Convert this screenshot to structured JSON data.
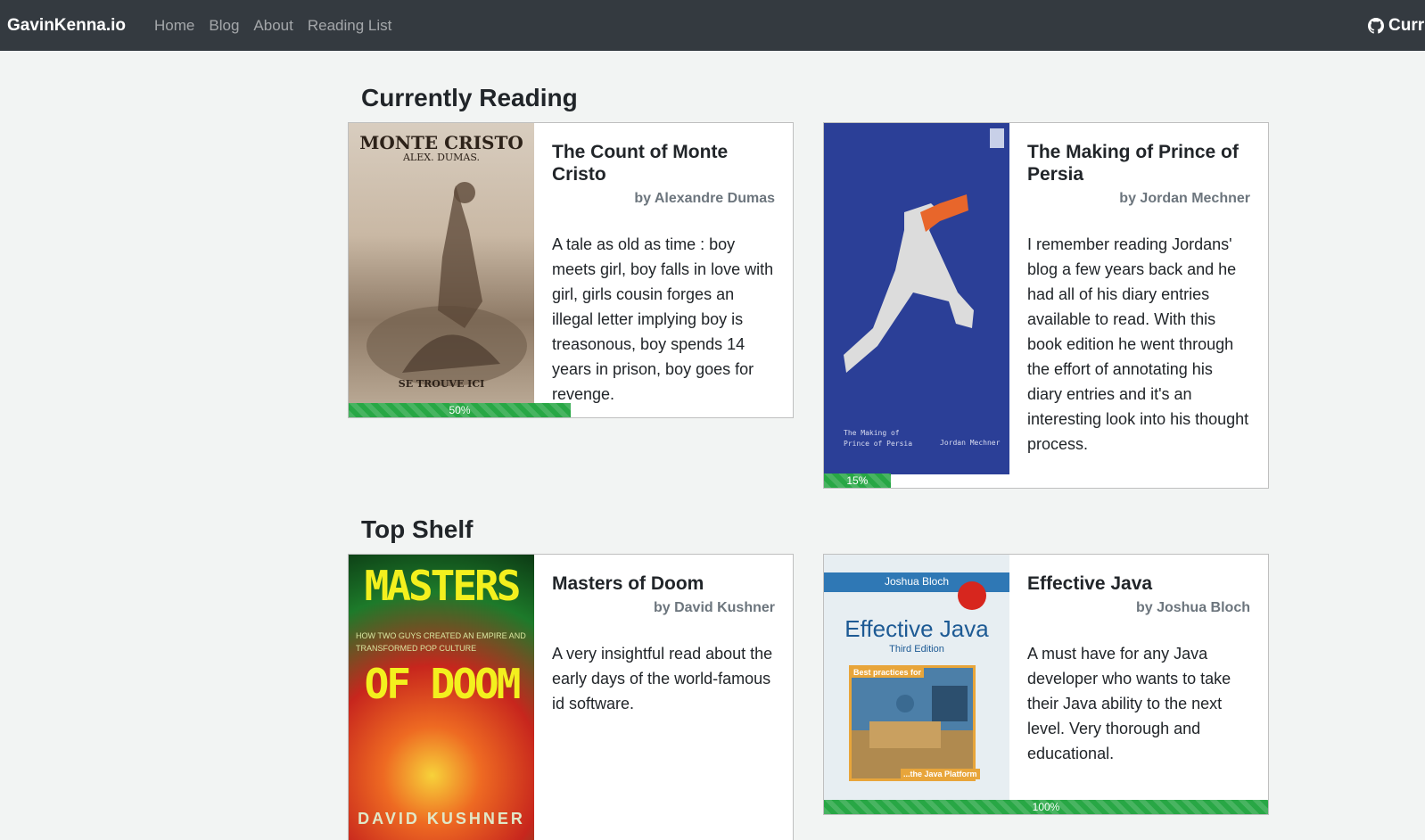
{
  "navbar": {
    "brand": "GavinKenna.io",
    "links": [
      "Home",
      "Blog",
      "About",
      "Reading List"
    ],
    "right_label": "Curr",
    "right_icon": "github-icon"
  },
  "sections": {
    "currently_reading": "Currently Reading",
    "top_shelf": "Top Shelf"
  },
  "books": [
    {
      "title": "The Count of Monte Cristo",
      "author": "by Alexandre Dumas",
      "description": "A tale as old as time : boy meets girl, boy falls in love with girl, girls cousin forges an illegal letter implying boy is treasonous, boy spends 14 years in prison, boy goes for revenge.",
      "progress": 50,
      "progress_label": "50%",
      "cover": {
        "line1": "MONTE CRISTO",
        "line2": "ALEX. DUMAS.",
        "line3": "SE TROUVE ICI"
      }
    },
    {
      "title": "The Making of Prince of Persia",
      "author": "by Jordan Mechner",
      "description": "I remember reading Jordans' blog a few years back and he had all of his diary entries available to read. With this book edition he went through the effort of annotating his diary entries and it's an interesting look into his thought process.",
      "progress": 15,
      "progress_label": "15%",
      "cover": {
        "line1": "The Making of\nPrince of Persia",
        "line2": "Jordan Mechner"
      }
    },
    {
      "title": "Masters of Doom",
      "author": "by David Kushner",
      "description": "A very insightful read about the early days of the world-famous id software.",
      "cover": {
        "line1": "MASTERS",
        "line2": "HOW TWO GUYS CREATED AN EMPIRE AND TRANSFORMED POP CULTURE",
        "line3": "OF DOOM",
        "line4": "DAVID KUSHNER"
      }
    },
    {
      "title": "Effective Java",
      "author": "by Joshua Bloch",
      "description": "A must have for any Java developer who wants to take their Java ability to the next level. Very thorough and educational.",
      "progress": 100,
      "progress_label": "100%",
      "cover": {
        "author": "Joshua Bloch",
        "title": "Effective Java",
        "edition": "Third Edition",
        "tag": "Best practices for",
        "footer": "...the Java Platform"
      }
    }
  ],
  "colors": {
    "navbar": "#343a40",
    "page": "#f2f4f3",
    "progress": "#28a745"
  }
}
